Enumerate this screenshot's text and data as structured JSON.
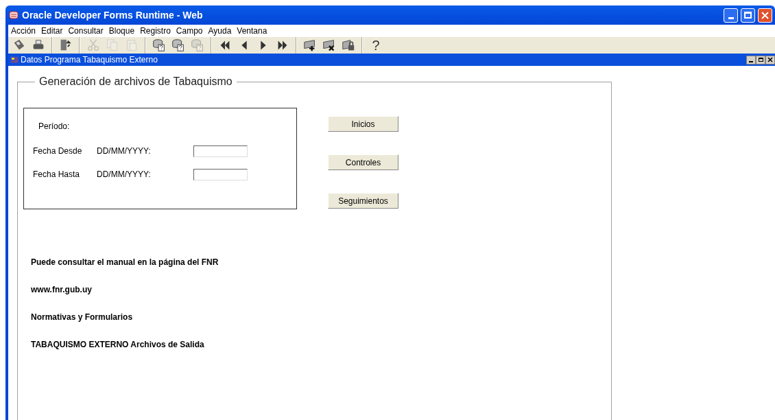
{
  "window": {
    "title": "Oracle Developer Forms Runtime - Web"
  },
  "menu": [
    "Acción",
    "Editar",
    "Consultar",
    "Bloque",
    "Registro",
    "Campo",
    "Ayuda",
    "Ventana"
  ],
  "toolbar": [
    {
      "kind": "save",
      "disabled": false
    },
    {
      "kind": "print",
      "disabled": false
    },
    {
      "kind": "sep"
    },
    {
      "kind": "exit",
      "disabled": false
    },
    {
      "kind": "sep"
    },
    {
      "kind": "cut",
      "disabled": true
    },
    {
      "kind": "copy",
      "disabled": true
    },
    {
      "kind": "paste",
      "disabled": true
    },
    {
      "kind": "sep"
    },
    {
      "kind": "query",
      "disabled": false
    },
    {
      "kind": "query",
      "disabled": false
    },
    {
      "kind": "query",
      "disabled": true
    },
    {
      "kind": "sep"
    },
    {
      "kind": "first",
      "disabled": false
    },
    {
      "kind": "prev",
      "disabled": false
    },
    {
      "kind": "next",
      "disabled": false
    },
    {
      "kind": "last",
      "disabled": false
    },
    {
      "kind": "sep"
    },
    {
      "kind": "insert",
      "disabled": false
    },
    {
      "kind": "delete",
      "disabled": false
    },
    {
      "kind": "lock",
      "disabled": false
    },
    {
      "kind": "sep"
    },
    {
      "kind": "help",
      "disabled": false,
      "text": "?"
    }
  ],
  "form_window": {
    "title": "Datos Programa Tabaquismo Externo"
  },
  "group": {
    "title": "Generación de archivos de Tabaquismo",
    "period_label": "Período:",
    "fields": [
      {
        "label": "Fecha Desde",
        "format": "DD/MM/YYYY:"
      },
      {
        "label": "Fecha Hasta",
        "format": "DD/MM/YYYY:"
      }
    ],
    "buttons": [
      "Inicios",
      "Controles",
      "Seguimientos"
    ],
    "notes": [
      "Puede consultar el manual en la página del FNR",
      "www.fnr.gub.uy",
      "Normativas y Formularios",
      "TABAQUISMO EXTERNO Archivos de Salida"
    ]
  }
}
